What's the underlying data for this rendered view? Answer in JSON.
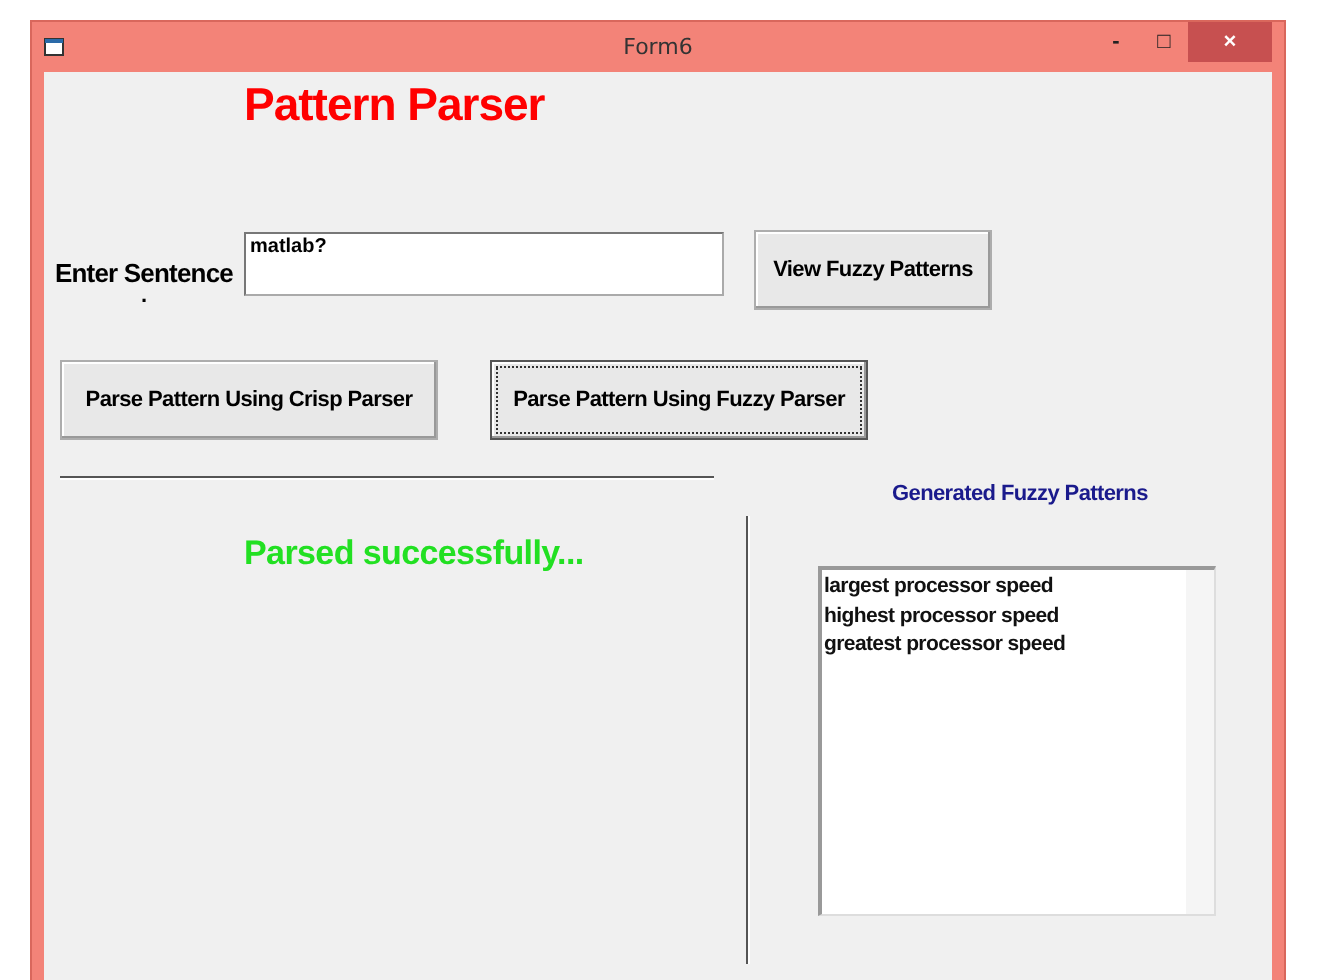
{
  "window": {
    "title": "Form6",
    "controls": [
      "-",
      "□",
      "×"
    ]
  },
  "heading": "Pattern Parser",
  "sentence": {
    "label": "Enter Sentence",
    "label_mark": ".",
    "value": "matlab?"
  },
  "view_button": {
    "label": "View Fuzzy  Patterns",
    "focused": false
  },
  "parse_buttons": [
    {
      "label": "Parse Pattern Using Crisp Parser",
      "focused": false
    },
    {
      "label": "Parse Pattern Using Fuzzy Parser",
      "focused": true
    }
  ],
  "status": "Parsed successfully...",
  "patterns": {
    "title": "Generated Fuzzy Patterns",
    "items": [
      "largest processor speed",
      "highest processor speed",
      "greatest processor speed"
    ]
  }
}
